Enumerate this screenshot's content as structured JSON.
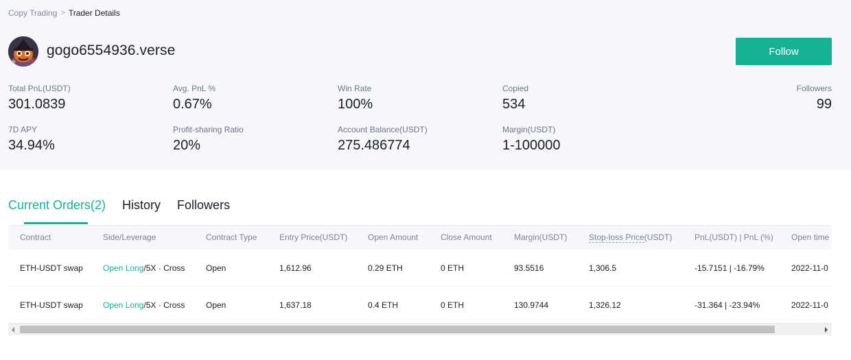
{
  "breadcrumb": {
    "parent": "Copy Trading",
    "separator": ">",
    "current": "Trader Details"
  },
  "trader": {
    "name": "gogo6554936.verse",
    "avatar_icon": "pumpkin-avatar"
  },
  "follow_label": "Follow",
  "colors": {
    "accent": "#14b194",
    "panel_bg": "#f6f7fa"
  },
  "stats": {
    "total_pnl": {
      "label": "Total PnL(USDT)",
      "value": "301.0839"
    },
    "avg_pnl": {
      "label": "Avg. PnL %",
      "value": "0.67%"
    },
    "win_rate": {
      "label": "Win Rate",
      "value": "100%"
    },
    "copied": {
      "label": "Copied",
      "value": "534"
    },
    "followers": {
      "label": "Followers",
      "value": "99"
    },
    "apy_7d": {
      "label": "7D APY",
      "value": "34.94%"
    },
    "profit_sharing": {
      "label": "Profit-sharing Ratio",
      "value": "20%"
    },
    "account_balance": {
      "label": "Account Balance(USDT)",
      "value": "275.486774"
    },
    "margin": {
      "label": "Margin(USDT)",
      "value": "1-100000"
    }
  },
  "tabs": [
    {
      "label": "Current Orders(2)"
    },
    {
      "label": "History"
    },
    {
      "label": "Followers"
    }
  ],
  "table": {
    "headers": {
      "contract": "Contract",
      "side": "Side/Leverage",
      "type": "Contract Type",
      "entry": "Entry Price(USDT)",
      "open_amount": "Open Amount",
      "close_amount": "Close Amount",
      "margin": "Margin(USDT)",
      "stop_loss_main": "Stop-loss Price",
      "stop_loss_unit": "(USDT)",
      "pnl": "PnL(USDT) | PnL (%)",
      "open_time": "Open time"
    },
    "rows": [
      {
        "contract": "ETH-USDT swap",
        "side": "Open Long",
        "leverage": "/5X · Cross",
        "type": "Open",
        "entry": "1,612.96",
        "open_amount": "0.29 ETH",
        "close_amount": "0 ETH",
        "margin": "93.5516",
        "stop_loss": "1,306.5",
        "pnl": "-15.7151 | -16.79%",
        "open_time": "2022-11-0"
      },
      {
        "contract": "ETH-USDT swap",
        "side": "Open Long",
        "leverage": "/5X · Cross",
        "type": "Open",
        "entry": "1,637.18",
        "open_amount": "0.4 ETH",
        "close_amount": "0 ETH",
        "margin": "130.9744",
        "stop_loss": "1,326.12",
        "pnl": "-31.364 | -23.94%",
        "open_time": "2022-11-0"
      }
    ]
  },
  "scrollbar": {
    "left_icon": "scroll-left-arrow-icon",
    "right_icon": "scroll-right-arrow-icon"
  }
}
